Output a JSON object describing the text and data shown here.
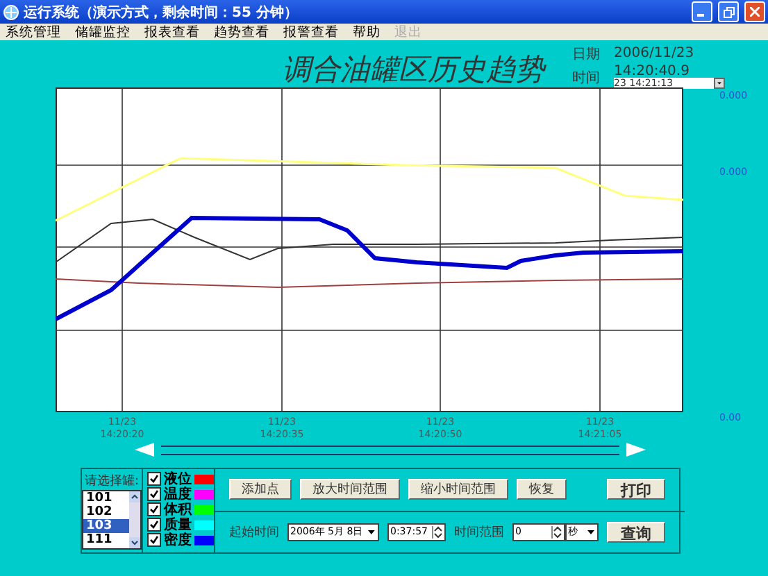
{
  "window": {
    "title": "运行系统（演示方式，剩余时间：55 分钟）"
  },
  "menu": [
    {
      "label": "系统管理",
      "disabled": false
    },
    {
      "label": "储罐监控",
      "disabled": false
    },
    {
      "label": "报表查看",
      "disabled": false
    },
    {
      "label": "趋势查看",
      "disabled": false
    },
    {
      "label": "报警查看",
      "disabled": false
    },
    {
      "label": "帮助",
      "disabled": false
    },
    {
      "label": "退出",
      "disabled": true
    }
  ],
  "header": {
    "title": "调合油罐区历史趋势",
    "date_label": "日期",
    "date": "2006/11/23",
    "time_label": "时间",
    "time": "14:20:40.9",
    "time_select": "23 14:21:13"
  },
  "chart": {
    "x_labels": [
      {
        "date": "11/23",
        "time": "14:20:20"
      },
      {
        "date": "11/23",
        "time": "14:20:35"
      },
      {
        "date": "11/23",
        "time": "14:20:50"
      },
      {
        "date": "11/23",
        "time": "14:21:05"
      }
    ],
    "scale_labels": [
      "0.000",
      "0.000",
      "0.00"
    ]
  },
  "tank_list": {
    "label": "请选择罐:",
    "items": [
      {
        "label": "101",
        "selected": false
      },
      {
        "label": "102",
        "selected": false
      },
      {
        "label": "103",
        "selected": true
      },
      {
        "label": "111",
        "selected": false
      }
    ]
  },
  "series": [
    {
      "label": "液位",
      "checked": true,
      "color": "#ff0000"
    },
    {
      "label": "温度",
      "checked": true,
      "color": "#ff00ff"
    },
    {
      "label": "体积",
      "checked": true,
      "color": "#00ff00"
    },
    {
      "label": "质量",
      "checked": true,
      "color": "#00ffff"
    },
    {
      "label": "密度",
      "checked": true,
      "color": "#0000ff"
    }
  ],
  "buttons": [
    "添加点",
    "放大时间范围",
    "缩小时间范围",
    "恢复"
  ],
  "print_button": "打印",
  "start_time": {
    "label": "起始时间",
    "date": "2006年 5月 8日",
    "time": "0:37:57"
  },
  "range": {
    "label": "时间范围",
    "value": "0",
    "unit": "秒"
  },
  "query_button": "查询"
}
